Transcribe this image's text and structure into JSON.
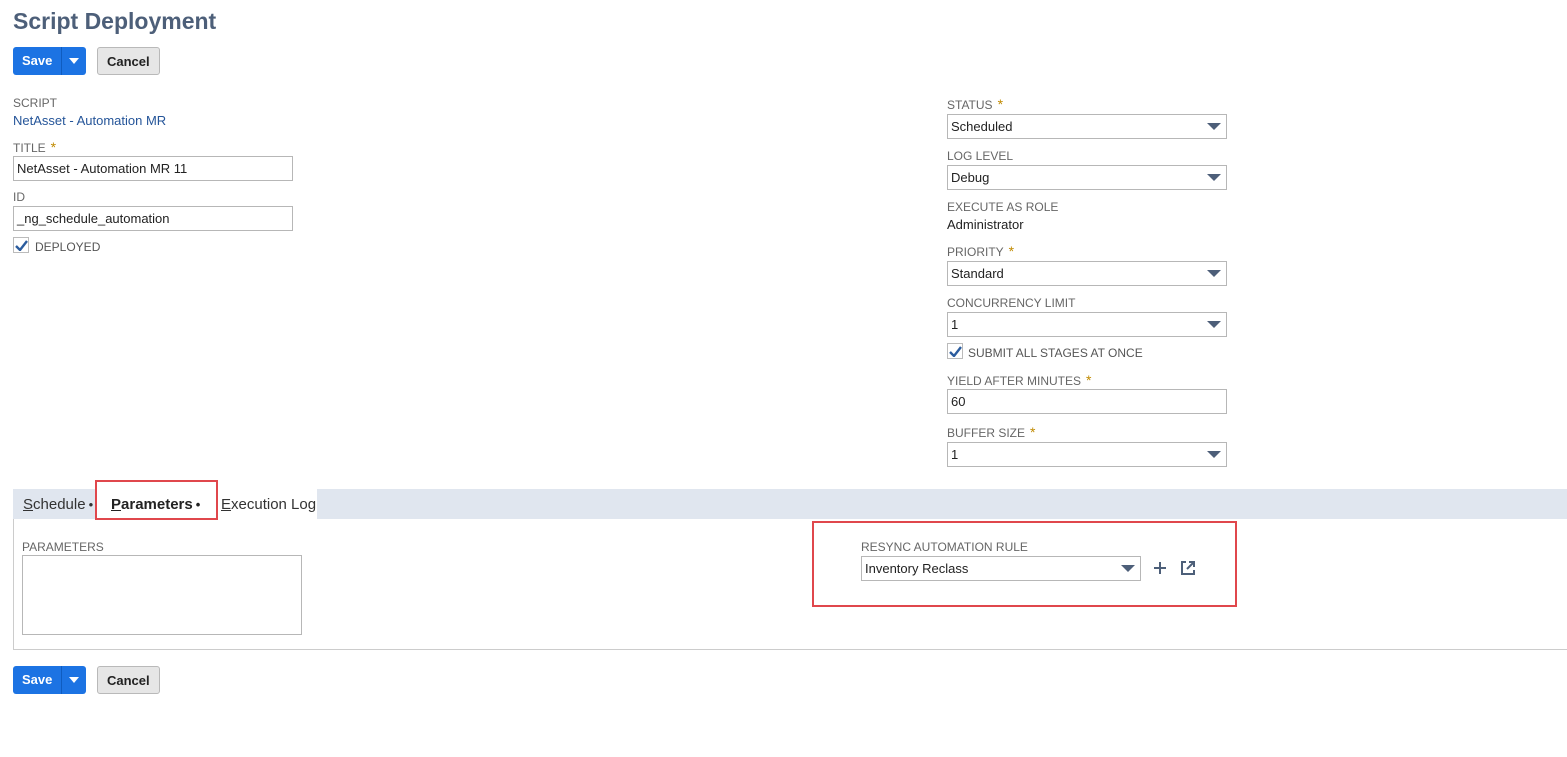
{
  "page": {
    "title": "Script Deployment"
  },
  "toolbar": {
    "save_label": "Save",
    "cancel_label": "Cancel"
  },
  "fields": {
    "script": {
      "label": "SCRIPT",
      "value": "NetAsset - Automation MR"
    },
    "title": {
      "label": "TITLE",
      "value": "NetAsset - Automation MR 11",
      "required": "*"
    },
    "id": {
      "label": "ID",
      "value": "_ng_schedule_automation"
    },
    "deployed": {
      "label": "DEPLOYED",
      "checked": true
    },
    "status": {
      "label": "STATUS",
      "value": "Scheduled",
      "required": "*"
    },
    "log_level": {
      "label": "LOG LEVEL",
      "value": "Debug"
    },
    "execute_as_role": {
      "label": "EXECUTE AS ROLE",
      "value": "Administrator"
    },
    "priority": {
      "label": "PRIORITY",
      "value": "Standard",
      "required": "*"
    },
    "concurrency_limit": {
      "label": "CONCURRENCY LIMIT",
      "value": "1"
    },
    "submit_all_stages": {
      "label": "SUBMIT ALL STAGES AT ONCE",
      "checked": true
    },
    "yield_after_minutes": {
      "label": "YIELD AFTER MINUTES",
      "value": "60",
      "required": "*"
    },
    "buffer_size": {
      "label": "BUFFER SIZE",
      "value": "1",
      "required": "*"
    }
  },
  "tabs": [
    {
      "label": "Schedule",
      "marker": "•",
      "active": false
    },
    {
      "label": "Parameters",
      "marker": "•",
      "active": true
    },
    {
      "label": "Execution Log",
      "marker": "",
      "active": false
    }
  ],
  "parameters_tab": {
    "parameters_label": "PARAMETERS",
    "parameters_value": "",
    "resync_rule": {
      "label": "RESYNC AUTOMATION RULE",
      "value": "Inventory Reclass"
    }
  },
  "icons": {
    "dropdown": "chevron-down-icon",
    "checkbox": "checkmark-icon",
    "add": "plus-icon",
    "open": "external-link-icon"
  },
  "colors": {
    "primary_button": "#1c73e3",
    "title": "#4d5f79",
    "link": "#255599",
    "required": "#c08a00",
    "highlight": "#e0474c",
    "tabbar": "#e0e6ef"
  }
}
